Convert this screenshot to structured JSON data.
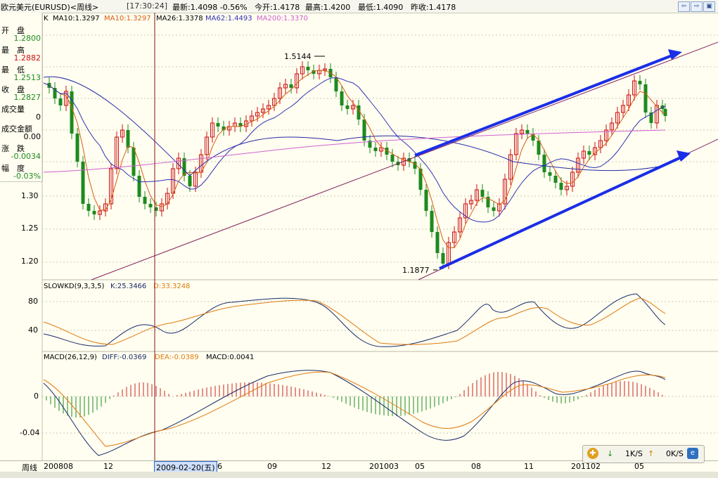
{
  "header": {
    "title": "欧元美元(EURUSD)<周线>",
    "time": "[17:30:24]",
    "latest": "最新:1.4098 -0.56%",
    "open_today": "今开:1.4178",
    "high": "最高:1.4200",
    "low": "最低:1.4090",
    "prev_close": "昨收:1.4178"
  },
  "ma_legend": {
    "date": "20090220",
    "k": "K",
    "ma10": "MA10:1.3297",
    "ma10b": "MA10:1.3297",
    "ma26": "MA26:1.3378",
    "ma62": "MA62:1.4493",
    "ma200": "MA200:1.3370"
  },
  "info_panel": {
    "open_label": "开　盘",
    "open_value": "1.2800",
    "high_label": "最　高",
    "high_value": "1.2882",
    "low_label": "最　低",
    "low_value": "1.2513",
    "close_label": "收　盘",
    "close_value": "1.2827",
    "volume_label": "成交量",
    "volume_value": "0",
    "amount_label": "成交金额",
    "amount_value": "0.00",
    "change_label": "涨　跌",
    "change_value": "-0.0034",
    "range_label": "幅　度",
    "range_value": "-0.03%"
  },
  "price_axis": [
    "1.30",
    "1.25",
    "1.20"
  ],
  "annotations": {
    "high": "1.5144",
    "low": "1.1877"
  },
  "kd": {
    "title": "SLOWKD(9,3,3,5)",
    "k": "K:25.3466",
    "d": "D:33.3248",
    "ticks": [
      "80",
      "40"
    ]
  },
  "macd": {
    "title": "MACD(26,12,9)",
    "diff": "DIFF:-0.0369",
    "dea": "DEA:-0.0389",
    "macd": "MACD:0.0041",
    "ticks": [
      "0",
      "-0.04"
    ]
  },
  "time_axis": {
    "period_label": "周线",
    "ticks": [
      "200808",
      "12",
      "6",
      "09",
      "12",
      "201003",
      "05",
      "08",
      "11",
      "201102",
      "05"
    ],
    "cursor_date": "2009-02-20(五)"
  },
  "toolbox": {
    "down": "↓",
    "speed1": "1K/S",
    "up": "↑",
    "speed2": "0K/S"
  },
  "colors": {
    "up": "#cc1010",
    "down": "#1e8a1e",
    "ma10": "#d85c10",
    "ma62": "#3232b4",
    "ma200": "#d060d0",
    "channel": "#1a2ee6",
    "cursor": "#8a1010",
    "k_line": "#1a2a6a",
    "d_line": "#e07a10"
  }
}
